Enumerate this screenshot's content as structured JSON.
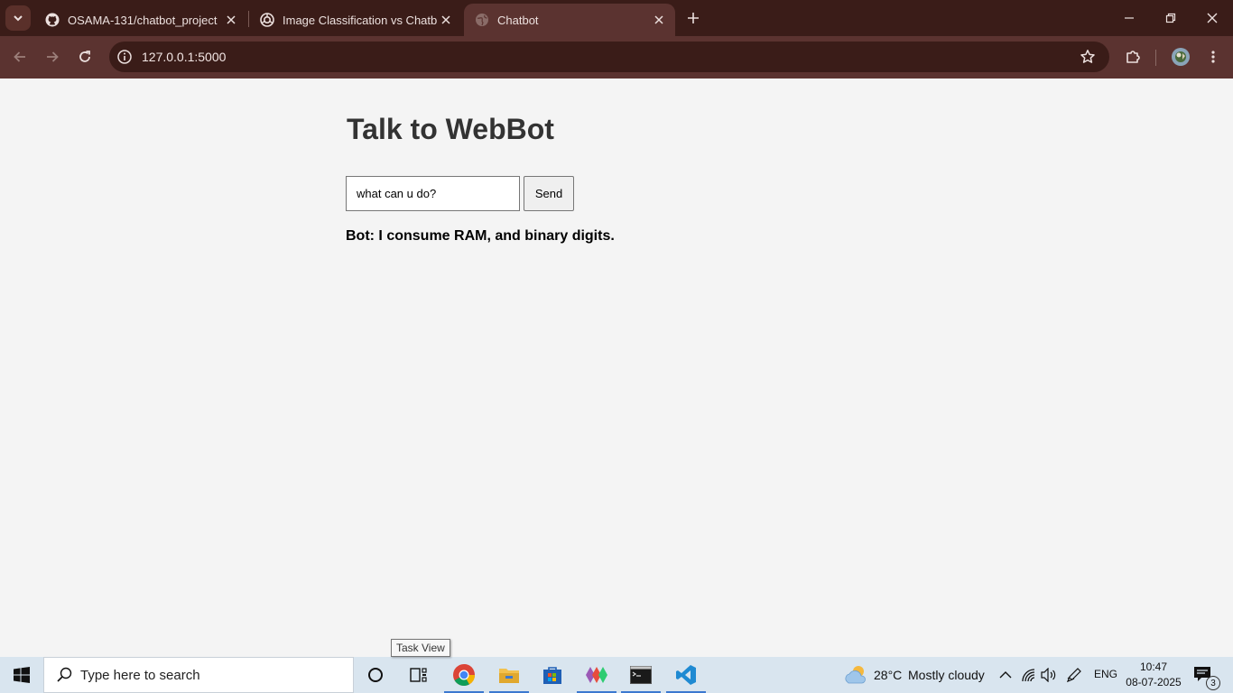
{
  "browser": {
    "tabs": [
      {
        "title": "OSAMA-131/chatbot_project",
        "icon": "github-icon",
        "active": false
      },
      {
        "title": "Image Classification vs Chatbot",
        "icon": "openai-icon",
        "active": false
      },
      {
        "title": "Chatbot",
        "icon": "globe-icon",
        "active": true
      }
    ],
    "url": "127.0.0.1:5000"
  },
  "page": {
    "title": "Talk to WebBot",
    "input_value": "what can u do?",
    "send_label": "Send",
    "bot_reply": "Bot: I consume RAM, and binary digits."
  },
  "tooltip": "Task View",
  "taskbar": {
    "search_placeholder": "Type here to search",
    "weather_temp": "28°C",
    "weather_desc": "Mostly cloudy",
    "language": "ENG",
    "time": "10:47",
    "date": "08-07-2025",
    "notification_count": "3"
  },
  "colors": {
    "chrome_dark": "#3a1c18",
    "chrome_active": "#5b3330",
    "page_bg": "#f4f4f4",
    "taskbar_bg": "#d9e5ef",
    "accent": "#3b78d0"
  }
}
